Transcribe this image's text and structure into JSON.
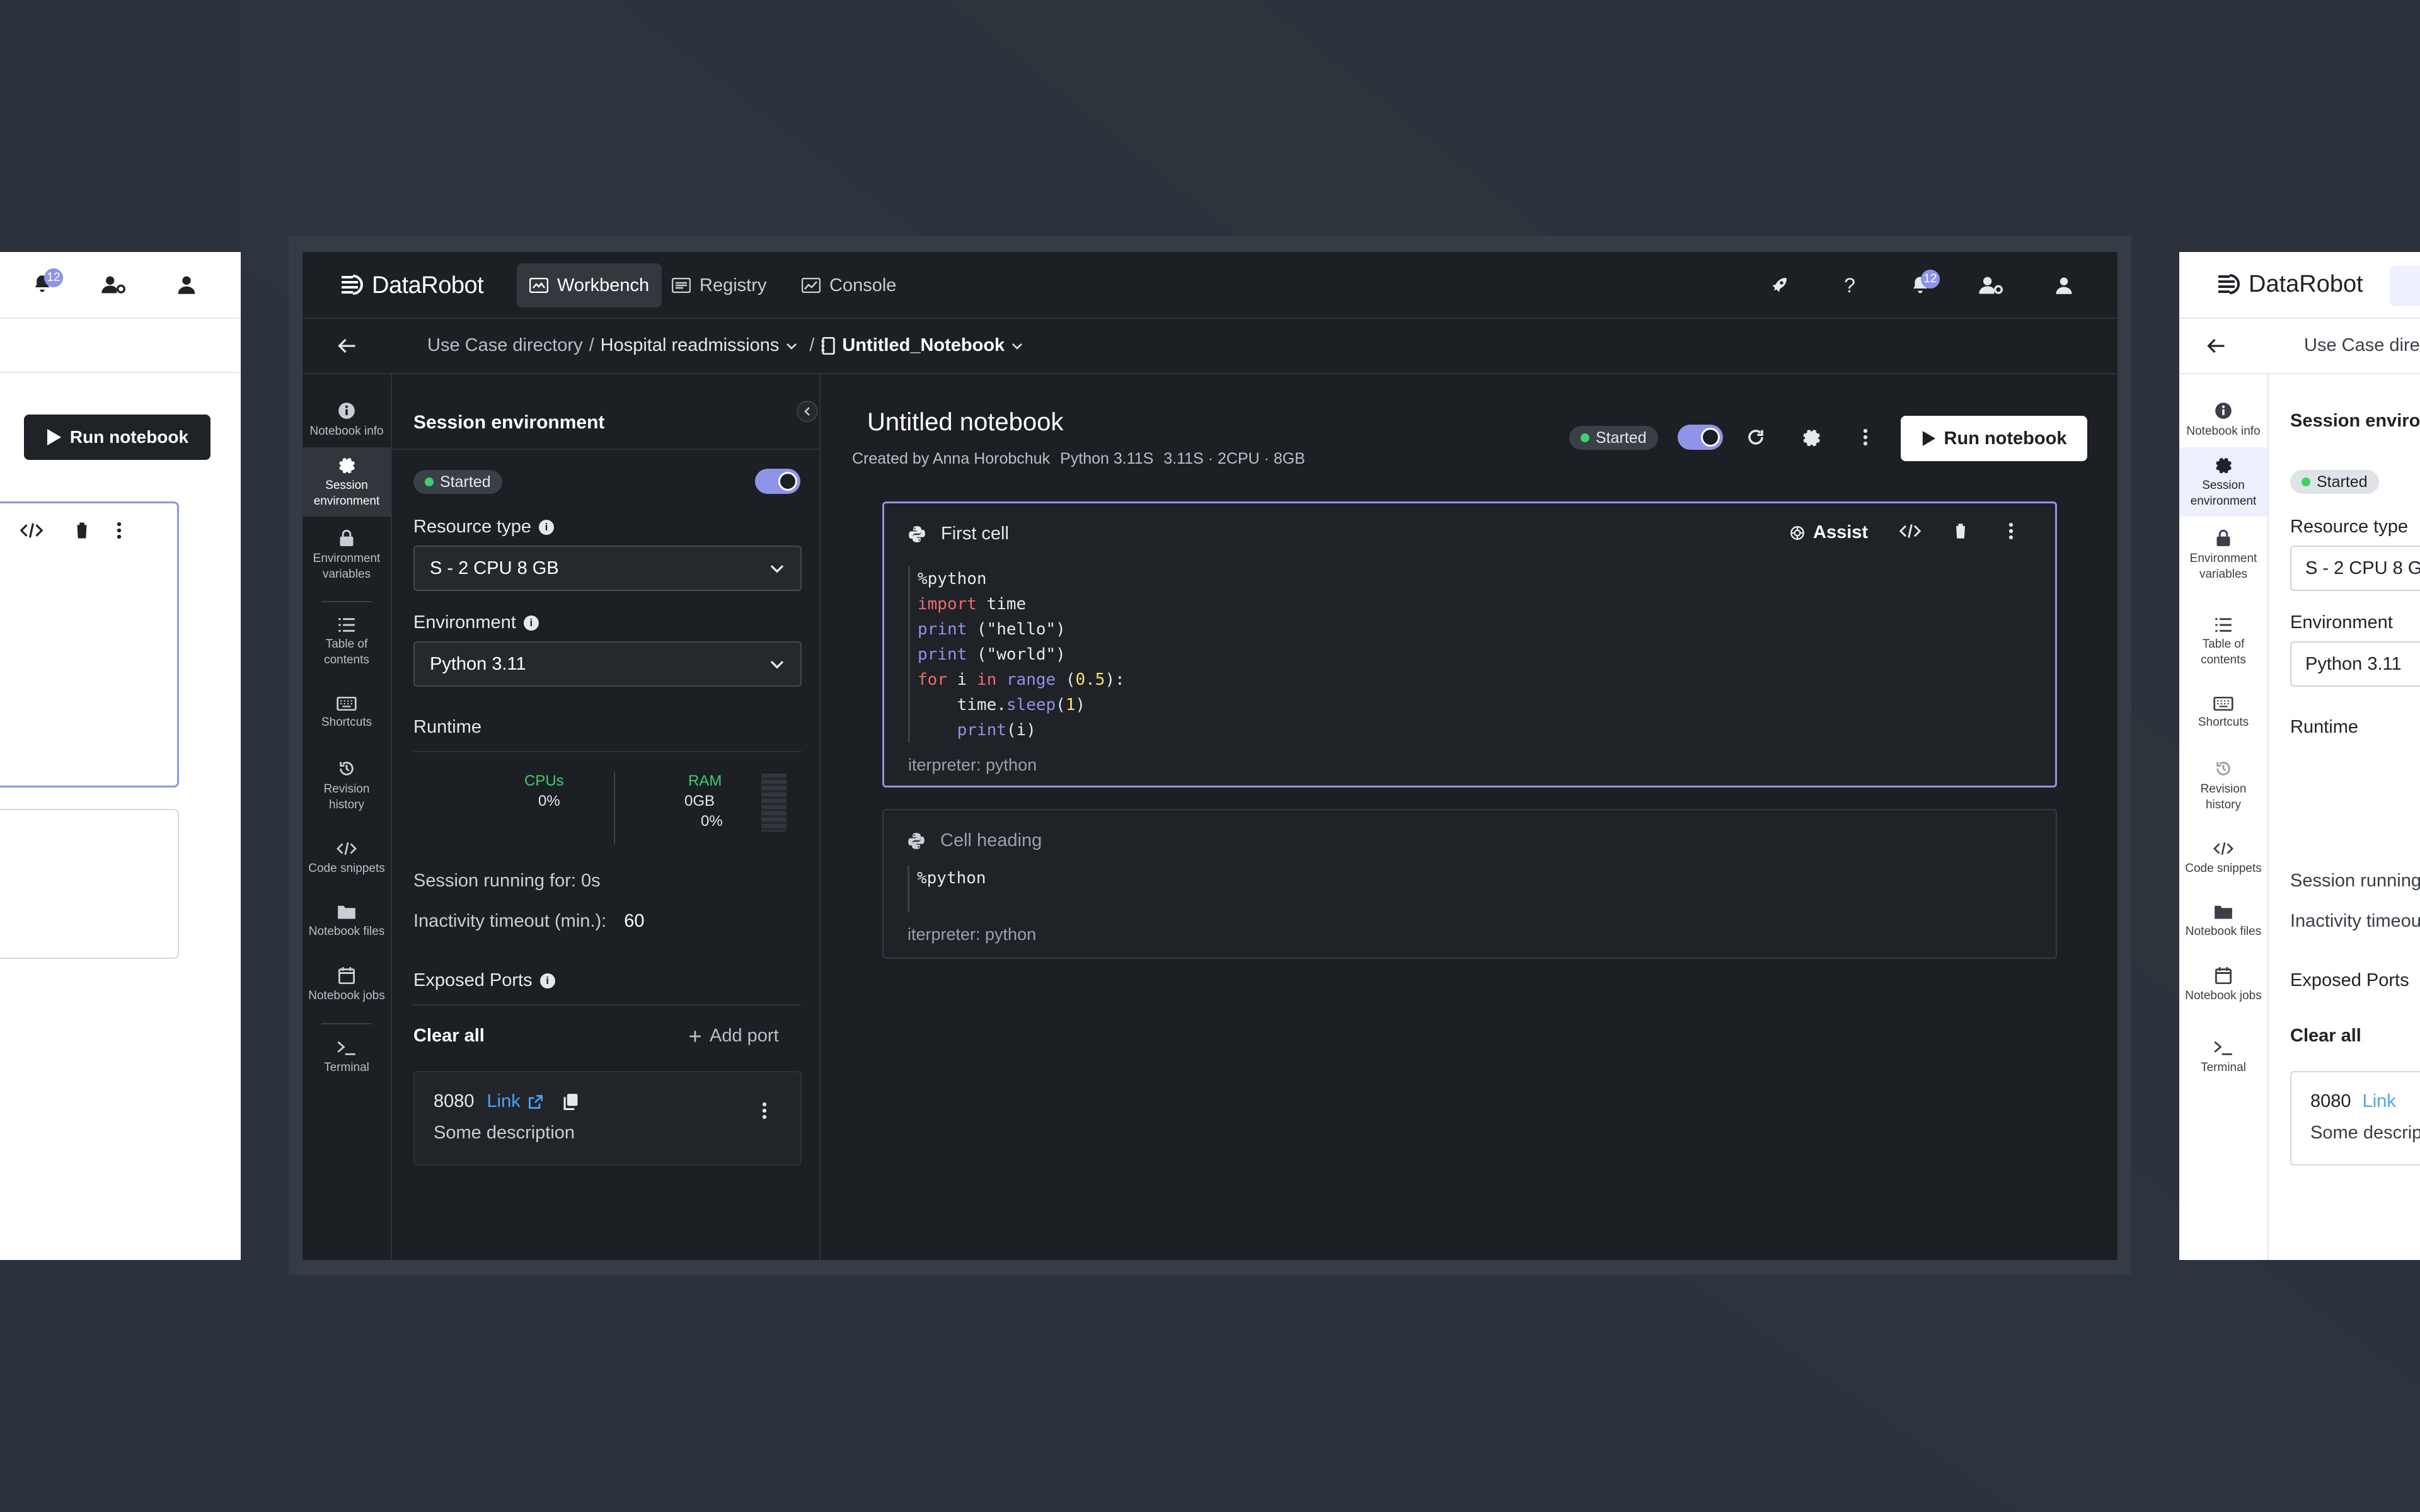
{
  "brand": {
    "name": "DataRobot"
  },
  "nav": {
    "items": [
      {
        "label": "Workbench",
        "icon": "workbench-icon",
        "active": true
      },
      {
        "label": "Registry",
        "icon": "registry-icon"
      },
      {
        "label": "Console",
        "icon": "console-icon"
      }
    ],
    "notification_count": "12",
    "help_label": "?"
  },
  "breadcrumb": {
    "root": "Use Case directory",
    "separator": "/",
    "use_case": "Hospital readmissions",
    "notebook": "Untitled_Notebook"
  },
  "rail": {
    "items": [
      {
        "key": "info",
        "label1": "Notebook info",
        "label2": ""
      },
      {
        "key": "session",
        "label1": "Session",
        "label2": "environment"
      },
      {
        "key": "envvars",
        "label1": "Environment",
        "label2": "variables"
      },
      {
        "key": "toc",
        "label1": "Table of",
        "label2": "contents"
      },
      {
        "key": "shortcuts",
        "label1": "Shortcuts",
        "label2": ""
      },
      {
        "key": "revision",
        "label1": "Revision",
        "label2": "history"
      },
      {
        "key": "snippets",
        "label1": "Code snippets",
        "label2": ""
      },
      {
        "key": "files",
        "label1": "Notebook files",
        "label2": ""
      },
      {
        "key": "jobs",
        "label1": "Notebook jobs",
        "label2": ""
      },
      {
        "key": "terminal",
        "label1": "Terminal",
        "label2": ""
      }
    ]
  },
  "session": {
    "title": "Session environment",
    "status": "Started",
    "resource_type_label": "Resource type",
    "resource_type_value": "S - 2 CPU 8 GB",
    "environment_label": "Environment",
    "environment_value": "Python 3.11",
    "runtime_label": "Runtime",
    "cpus_label": "CPUs",
    "cpus_value": "0%",
    "ram_label": "RAM",
    "ram_value": "0GB",
    "ram_pct": "0%",
    "running_for_label": "Session running for: 0s",
    "inactivity_label": "Inactivity timeout (min.):",
    "inactivity_value": "60",
    "ports_label": "Exposed Ports",
    "clear_all": "Clear all",
    "add_port": "Add port",
    "port": {
      "number": "8080",
      "link_label": "Link",
      "description": "Some description"
    }
  },
  "notebook": {
    "title": "Untitled notebook",
    "created_by": "Created by Anna Horobchuk",
    "python": "Python 3.11S",
    "resources": "3.11S · 2CPU · 8GB",
    "status": "Started",
    "run_label": "Run notebook",
    "cells": [
      {
        "heading": "First cell",
        "assist_label": "Assist",
        "interpreter": "iterpreter: python"
      },
      {
        "heading": "Cell heading",
        "code": "%python",
        "interpreter": "iterpreter: python"
      }
    ],
    "code_lines": {
      "l1": "%python",
      "l2_kw": "import",
      "l2_rest": " time",
      "l3_fn": "print",
      "l3_rest": " (\"hello\")",
      "l4_fn": "print",
      "l4_rest": " (\"world\")",
      "l5_kw1": "for",
      "l5_var": " i ",
      "l5_kw2": "in",
      "l5_fn": " range",
      "l5_open": " (",
      "l5_num": "0.5",
      "l5_close": "):",
      "l6_pre": "    time.",
      "l6_fn": "sleep",
      "l6_open": "(",
      "l6_num": "1",
      "l6_close": ")",
      "l7_pre": "    ",
      "l7_fn": "print",
      "l7_rest": "(i)"
    }
  },
  "right_frame": {
    "breadcrumb_partial": "Use Case dire",
    "session_partial": "Session environ",
    "resource_partial": "Resource type",
    "resource_value_partial": "S - 2 CPU 8 G",
    "env_label": "Environment",
    "env_value_partial": "Python 3.11",
    "runtime_label": "Runtime",
    "running_partial": "Session running",
    "timeout_partial": "Inactivity timeou",
    "ports_label": "Exposed Ports",
    "clear_all": "Clear all",
    "port_number": "8080",
    "link_label": "Link",
    "desc_partial": "Some descrip"
  },
  "left_frame": {
    "run_label": "Run notebook",
    "notification_count": "12"
  },
  "colors": {
    "background": "#2c323b",
    "app_bg": "#1c1f23",
    "accent": "#8f94e8",
    "started_dot": "#3ecf6e",
    "link": "#4ea3f5"
  }
}
